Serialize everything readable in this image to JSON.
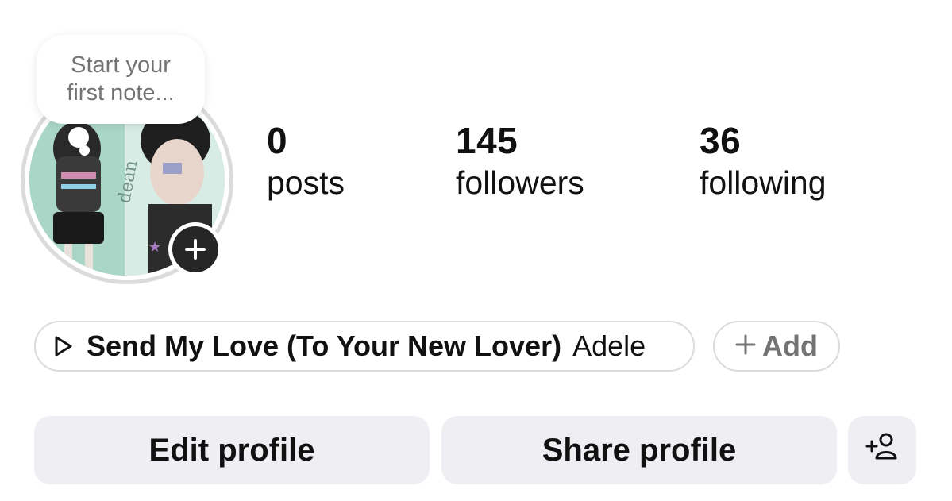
{
  "profile": {
    "note_prompt": "Start your first note...",
    "stats": {
      "posts": {
        "value": "0",
        "label": "posts"
      },
      "followers": {
        "value": "145",
        "label": "followers"
      },
      "following": {
        "value": "36",
        "label": "following"
      }
    },
    "music": {
      "title": "Send My Love (To Your New Lover)",
      "artist": "Adele",
      "icon": "play-outline-icon"
    },
    "add_chip": {
      "label": "Add",
      "icon": "plus-icon"
    },
    "actions": {
      "edit_label": "Edit profile",
      "share_label": "Share profile",
      "suggest_icon": "add-person-icon"
    },
    "avatar": {
      "add_story_icon": "plus-icon",
      "ring_color": "#dbdbdb"
    }
  },
  "colors": {
    "text": "#111111",
    "muted": "#737373",
    "button_bg": "#efeff3",
    "border": "#dbdbdb",
    "badge_bg": "#262626"
  }
}
